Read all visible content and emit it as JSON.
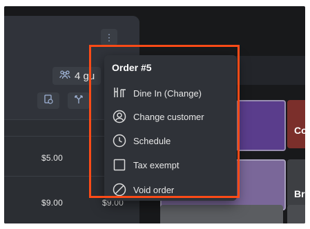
{
  "order_panel": {
    "guests_label": "4 gu",
    "prices": [
      "$5.00",
      "$9.00",
      "$9.00"
    ]
  },
  "products": {
    "tiles": [
      {
        "label": "",
        "color": "#5a3d8c"
      },
      {
        "label": "Co",
        "color": "#7b2f2b"
      },
      {
        "label": "",
        "color": "#7a6799"
      },
      {
        "label": "Bru",
        "color": "#3d3f43"
      },
      {
        "label": "",
        "color": "#5b5d61"
      }
    ]
  },
  "menu": {
    "title": "Order #5",
    "items": [
      {
        "label": "Dine In (Change)",
        "icon": "dine-in-icon"
      },
      {
        "label": "Change customer",
        "icon": "customer-icon"
      },
      {
        "label": "Schedule",
        "icon": "clock-icon"
      },
      {
        "label": "Tax exempt",
        "icon": "checkbox-icon"
      },
      {
        "label": "Void order",
        "icon": "void-icon"
      }
    ]
  },
  "colors": {
    "highlight": "#ff4b17",
    "menu_bg": "#2f3238",
    "panel_bg": "#2b2e33"
  }
}
